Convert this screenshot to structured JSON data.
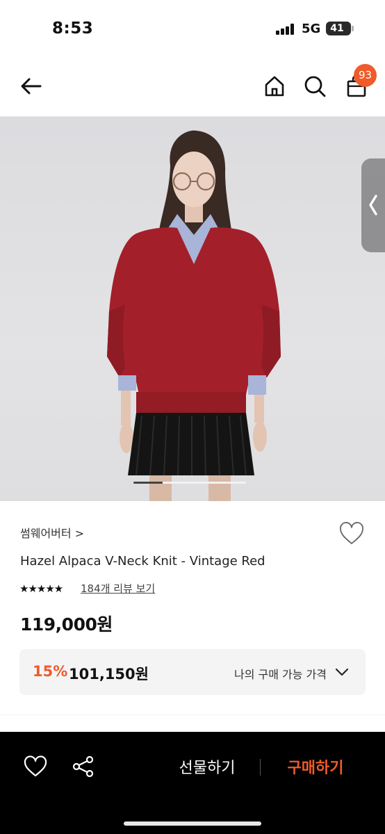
{
  "status_bar": {
    "time": "8:53",
    "network": "5G",
    "battery": "41"
  },
  "header": {
    "back_icon": "arrow-left-icon",
    "home_icon": "home-icon",
    "search_icon": "search-icon",
    "cart_icon": "shopping-bag-icon",
    "cart_count": "93"
  },
  "product": {
    "brand": "썸웨어버터",
    "brand_chevron": ">",
    "title": "Hazel Alpaca V-Neck Knit - Vintage Red",
    "rating_stars": "★★★★★",
    "rating_value": 5,
    "review_link": "184개 리뷰 보기",
    "price": "119,000원",
    "discount": {
      "rate": "15%",
      "price": "101,150원",
      "label": "나의 구매 가능 가격"
    }
  },
  "bottom_bar": {
    "gift_label": "선물하기",
    "buy_label": "구매하기"
  },
  "colors": {
    "accent": "#ef5b2a",
    "bottom_bar_bg": "#000000",
    "discount_box_bg": "#f4f4f5",
    "sweater": "#a3202a"
  }
}
